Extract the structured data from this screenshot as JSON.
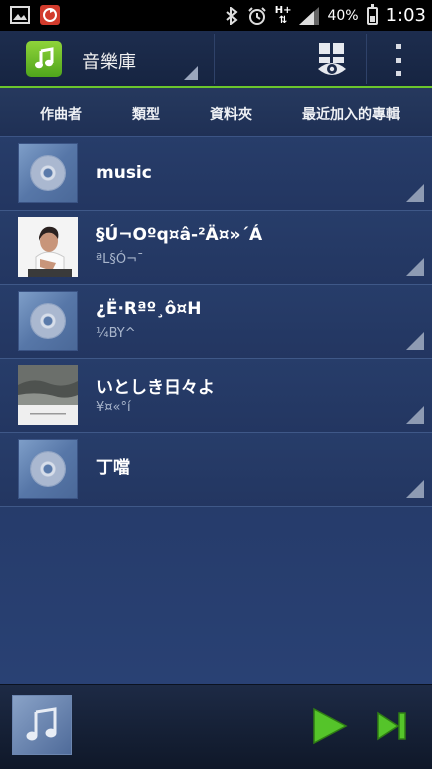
{
  "status_bar": {
    "battery": "40%",
    "time": "1:03",
    "network_top": "H+",
    "battery_level": 0.4
  },
  "action_bar": {
    "title": "音樂庫",
    "view_icon": "view-toggle-icon",
    "menu_icon": "overflow-menu-icon"
  },
  "tabs": [
    {
      "label": "作曲者"
    },
    {
      "label": "類型"
    },
    {
      "label": "資料夾"
    },
    {
      "label": "最近加入的專輯"
    }
  ],
  "list": [
    {
      "title": "music",
      "subtitle": "",
      "art": "cd-icon"
    },
    {
      "title": "§Ú¬Oºq¤â-²Ä¤»´Á",
      "subtitle": "ªL§Ó¬¯",
      "art": "person-photo"
    },
    {
      "title": "¿Ë·Rªº¸ô¤H",
      "subtitle": "¼BY^",
      "art": "cd-icon"
    },
    {
      "title": "いとしき日々よ",
      "subtitle": "¥¤«°í",
      "art": "landscape-photo"
    },
    {
      "title": "丁噹",
      "subtitle": "",
      "art": "cd-icon"
    }
  ],
  "player": {
    "art_icon": "music-note-icon",
    "play_icon": "play-icon",
    "next_icon": "skip-next-icon"
  },
  "colors": {
    "accent_green": "#6bc62c",
    "background": "#223561"
  }
}
